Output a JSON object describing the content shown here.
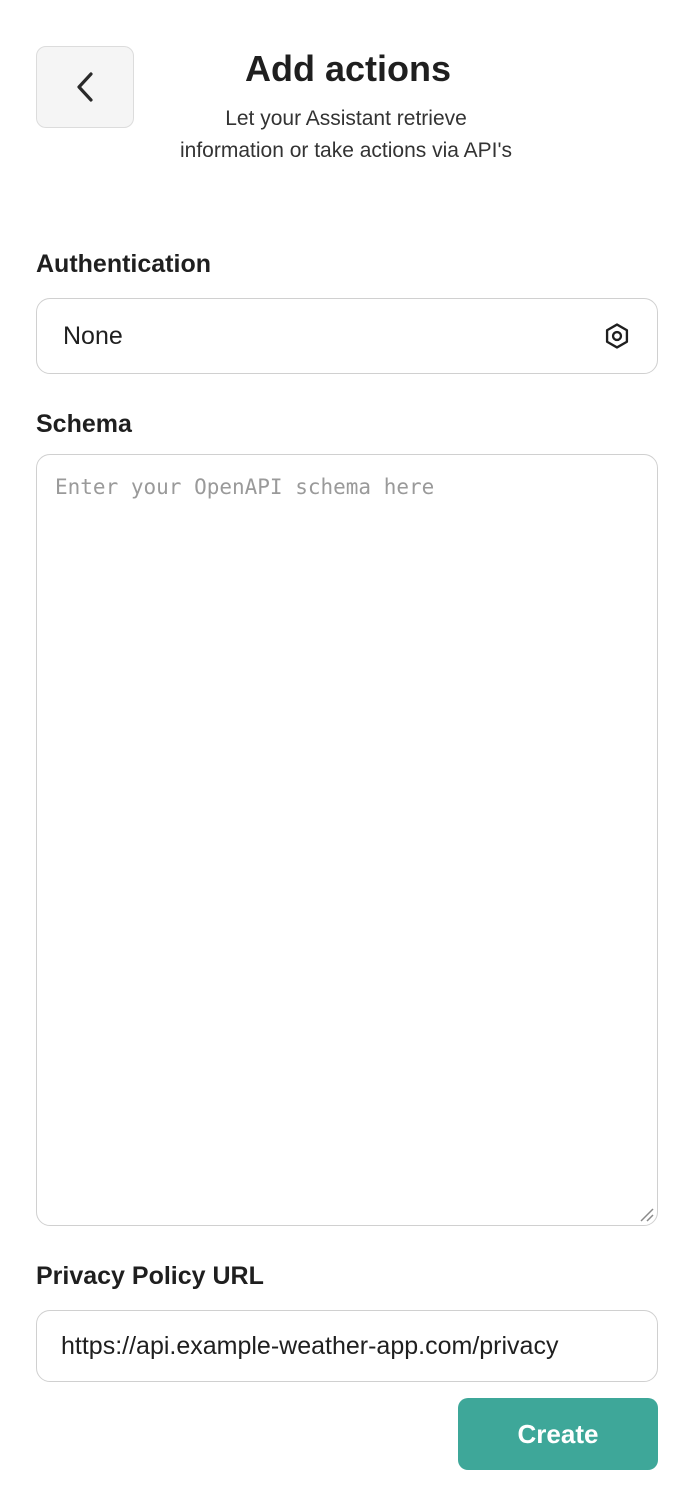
{
  "header": {
    "back_icon": "chevron-left-icon",
    "title": "Add actions",
    "subtitle": "Let your Assistant retrieve information or take actions via API's"
  },
  "authentication": {
    "label": "Authentication",
    "value": "None",
    "icon": "gear-icon"
  },
  "schema": {
    "label": "Schema",
    "value": "",
    "placeholder": "Enter your OpenAPI schema here"
  },
  "privacy": {
    "label": "Privacy Policy URL",
    "value": "https://api.example-weather-app.com/privacy"
  },
  "actions": {
    "create_label": "Create"
  },
  "colors": {
    "accent": "#3ea799",
    "border": "#d0d0d0",
    "back_button_bg": "#f5f5f5"
  }
}
